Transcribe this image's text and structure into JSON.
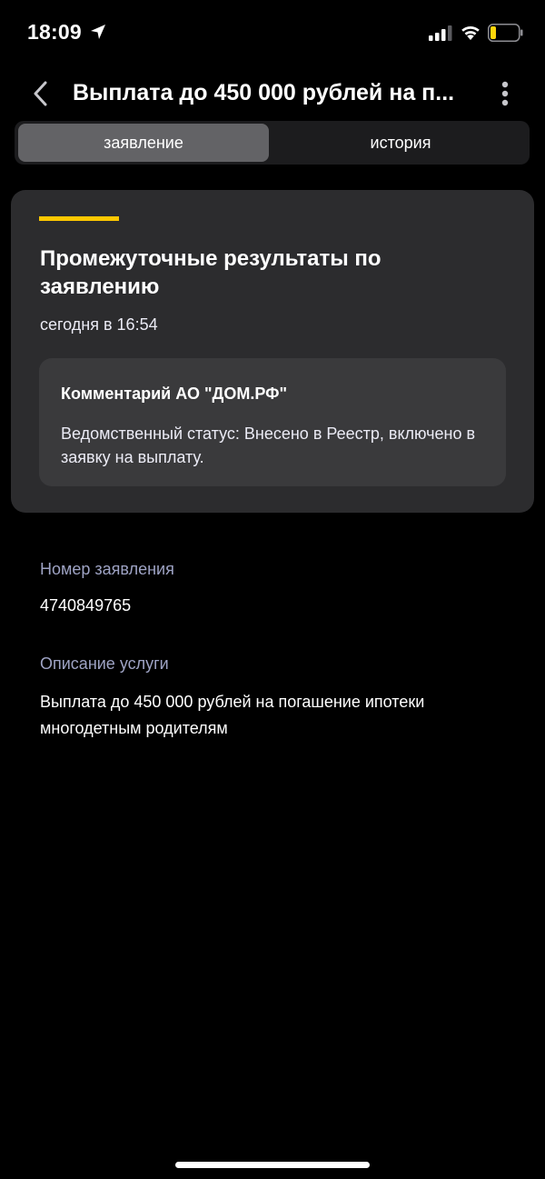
{
  "status_bar": {
    "time": "18:09",
    "icons": [
      "location-arrow-icon",
      "signal-icon",
      "wifi-icon",
      "battery-icon"
    ],
    "battery_color": "#ffd60a"
  },
  "nav": {
    "back_icon": "chevron-left-icon",
    "title": "Выплата до 450 000 рублей на п...",
    "more_icon": "more-vertical-icon"
  },
  "tabs": [
    {
      "label": "заявление",
      "active": true
    },
    {
      "label": "история",
      "active": false
    }
  ],
  "result_card": {
    "accent_color": "#ffc800",
    "title": "Промежуточные результаты по заявлению",
    "date": "сегодня в 16:54",
    "comment": {
      "title": "Комментарий АО \"ДОМ.РФ\"",
      "text": "Ведомственный статус: Внесено в Реестр, включено в заявку на выплату."
    }
  },
  "details": {
    "number_label": "Номер заявления",
    "number_value": "4740849765",
    "description_label": "Описание услуги",
    "description_value": "Выплата до 450 000 рублей на погашение ипотеки многодетным родителям"
  }
}
